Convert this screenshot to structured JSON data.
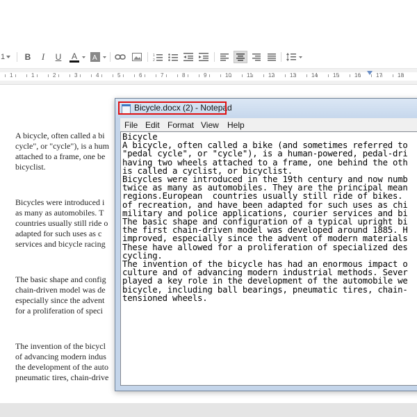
{
  "toolbar": {
    "left_partial": "1",
    "buttons": [
      "bold-icon",
      "italic-icon",
      "underline-icon",
      "text-color-icon",
      "highlight-color-icon",
      "link-icon",
      "comment-icon",
      "numbered-list-icon",
      "bulleted-list-icon",
      "decrease-indent-icon",
      "increase-indent-icon",
      "align-left-icon",
      "align-center-icon",
      "align-right-icon",
      "justify-icon",
      "line-spacing-icon"
    ],
    "bold": "B",
    "italic": "I",
    "underline": "U",
    "text_color": "A"
  },
  "ruler": {
    "numbers": [
      "1",
      "1",
      "2",
      "3",
      "4",
      "5",
      "6",
      "7",
      "8",
      "9",
      "10",
      "11",
      "12",
      "13",
      "14",
      "15",
      "16",
      "17",
      "18"
    ]
  },
  "document": {
    "paragraphs": [
      "A bicycle, often called a bi\ncycle\", or \"cycle\"), is a hum\nattached to a frame, one be\nbicyclist.",
      "Bicycles were introduced i\nas many as automobiles. T\ncountries usually still ride o\nadapted for such uses as c\nservices and bicycle racing",
      "The basic shape and config\nchain-driven model was de\nespecially since the advent\nfor a proliferation of speci",
      "The invention of the bicycl\nof advancing modern indus\nthe development of the auto\npneumatic tires, chain-drive"
    ]
  },
  "notepad": {
    "title": "Bicycle.docx (2) - Notepad",
    "menu": [
      "File",
      "Edit",
      "Format",
      "View",
      "Help"
    ],
    "text": "Bicycle\nA bicycle, often called a bike (and sometimes referred to\n\"pedal cycle\", or \"cycle\"), is a human-powered, pedal-dri\nhaving two wheels attached to a frame, one behind the oth\nis called a cyclist, or bicyclist.\nBicycles were introduced in the 19th century and now numb\ntwice as many as automobiles. They are the principal mean\nregions.European  countries usually still ride of bikes.\nof recreation, and have been adapted for such uses as chi\nmilitary and police applications, courier services and bi\nThe basic shape and configuration of a typical upright bi\nthe first chain-driven model was developed around 1885. H\nimproved, especially since the advent of modern materials\nThese have allowed for a proliferation of specialized des\ncycling.\nThe invention of the bicycle has had an enormous impact o\nculture and of advancing modern industrial methods. Sever\nplayed a key role in the development of the automobile we\nbicycle, including ball bearings, pneumatic tires, chain-\ntensioned wheels."
  },
  "colors": {
    "highlight_border": "#e01010",
    "titlebar": "#c6d7ec"
  }
}
